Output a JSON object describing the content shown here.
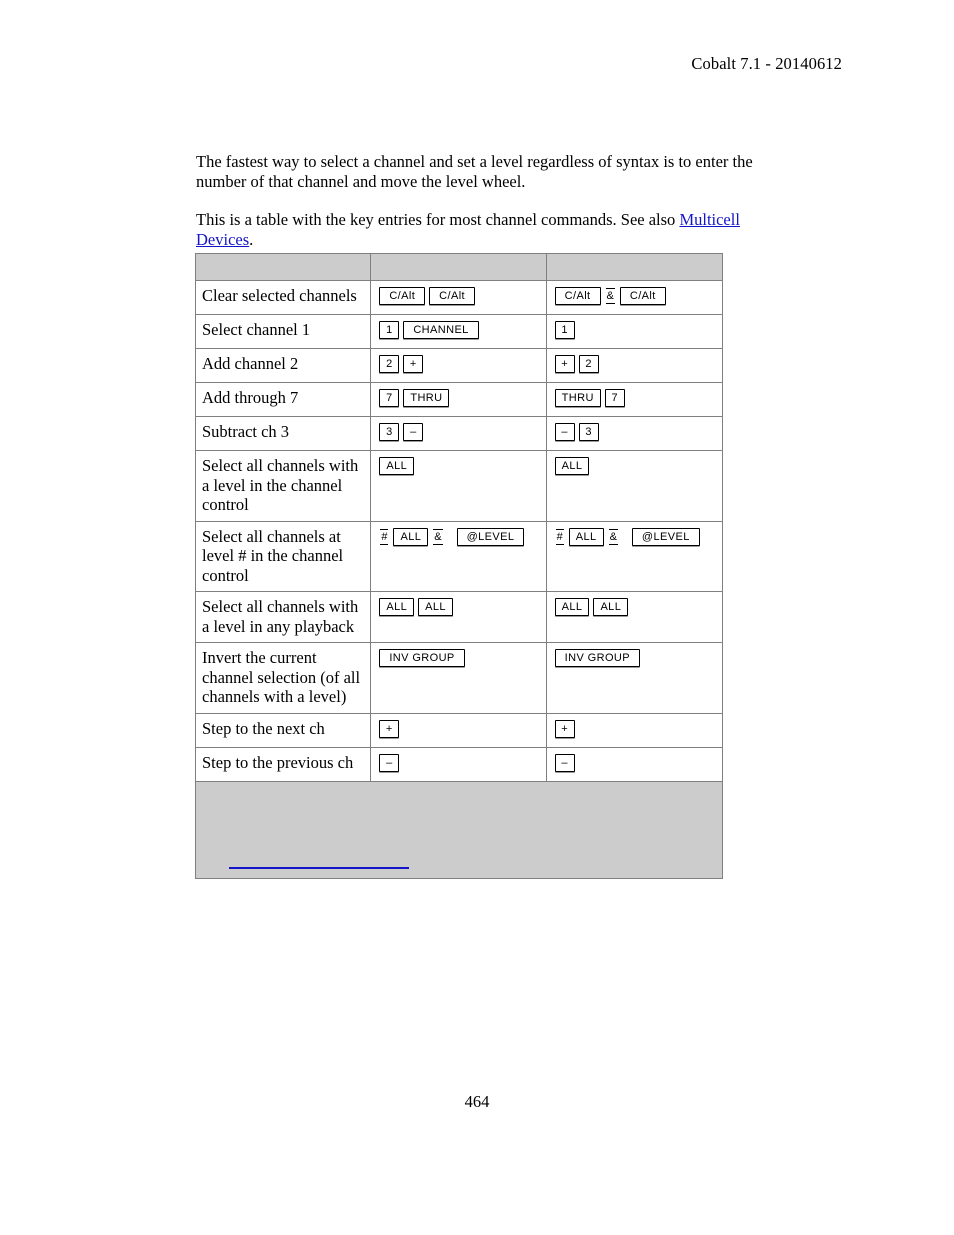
{
  "document": {
    "header": "Cobalt 7.1 - 20140612",
    "page_number": "464",
    "paragraphs": {
      "intro": "The fastest way to select a channel and set a level regardless of syntax is to enter the number of that channel and move the level wheel.",
      "table_lead_before_link": "This is a table with the key entries for most channel commands. See also ",
      "table_lead_link": "Multicell Devices",
      "table_lead_after_link": "."
    },
    "link_color": "#1414c8",
    "header_fill": "#cccccc",
    "border_color": "#7f7f7f"
  },
  "key_table": {
    "headers": [
      "",
      "",
      ""
    ],
    "rows": [
      {
        "description": "Clear selected channels",
        "syntax_a": [
          {
            "type": "key",
            "label": "C/Alt"
          },
          {
            "type": "key",
            "label": "C/Alt"
          }
        ],
        "syntax_b": [
          {
            "type": "key",
            "label": "C/Alt"
          },
          {
            "type": "lit",
            "label": "&"
          },
          {
            "type": "key",
            "label": "C/Alt"
          }
        ]
      },
      {
        "description": "Select channel 1",
        "syntax_a": [
          {
            "type": "key",
            "label": "1"
          },
          {
            "type": "key",
            "label": "CHANNEL"
          }
        ],
        "syntax_b": [
          {
            "type": "key",
            "label": "1"
          }
        ]
      },
      {
        "description": "Add channel 2",
        "syntax_a": [
          {
            "type": "key",
            "label": "2"
          },
          {
            "type": "key",
            "label": "+"
          }
        ],
        "syntax_b": [
          {
            "type": "key",
            "label": "+"
          },
          {
            "type": "key",
            "label": "2"
          }
        ]
      },
      {
        "description": "Add through 7",
        "syntax_a": [
          {
            "type": "key",
            "label": "7"
          },
          {
            "type": "key",
            "label": "THRU"
          }
        ],
        "syntax_b": [
          {
            "type": "key",
            "label": "THRU"
          },
          {
            "type": "key",
            "label": "7"
          }
        ]
      },
      {
        "description": "Subtract ch 3",
        "syntax_a": [
          {
            "type": "key",
            "label": "3"
          },
          {
            "type": "key",
            "label": "–"
          }
        ],
        "syntax_b": [
          {
            "type": "key",
            "label": "–"
          },
          {
            "type": "key",
            "label": "3"
          }
        ]
      },
      {
        "description": "Select all channels with a level in the channel control",
        "syntax_a": [
          {
            "type": "key",
            "label": "ALL"
          }
        ],
        "syntax_b": [
          {
            "type": "key",
            "label": "ALL"
          }
        ]
      },
      {
        "description": "Select all channels at level # in the channel control",
        "syntax_a": [
          {
            "type": "lit",
            "label": "#"
          },
          {
            "type": "key",
            "label": "ALL"
          },
          {
            "type": "lit",
            "label": "&"
          },
          {
            "type": "gap"
          },
          {
            "type": "key",
            "label": "@LEVEL"
          }
        ],
        "syntax_b": [
          {
            "type": "lit",
            "label": "#"
          },
          {
            "type": "key",
            "label": "ALL"
          },
          {
            "type": "lit",
            "label": "&"
          },
          {
            "type": "gap"
          },
          {
            "type": "key",
            "label": "@LEVEL"
          }
        ]
      },
      {
        "description": "Select all channels with a level in any playback",
        "syntax_a": [
          {
            "type": "key",
            "label": "ALL"
          },
          {
            "type": "key",
            "label": "ALL"
          }
        ],
        "syntax_b": [
          {
            "type": "key",
            "label": "ALL"
          },
          {
            "type": "key",
            "label": "ALL"
          }
        ]
      },
      {
        "description": "Invert the current channel selection (of all channels with a level)",
        "syntax_a": [
          {
            "type": "key",
            "label": "INV GROUP"
          }
        ],
        "syntax_b": [
          {
            "type": "key",
            "label": "INV GROUP"
          }
        ]
      },
      {
        "description": "Step to the next ch",
        "syntax_a": [
          {
            "type": "key",
            "label": "+"
          }
        ],
        "syntax_b": [
          {
            "type": "key",
            "label": "+"
          }
        ]
      },
      {
        "description": "Step to the previous ch",
        "syntax_a": [
          {
            "type": "key",
            "label": "–"
          }
        ],
        "syntax_b": [
          {
            "type": "key",
            "label": "–"
          }
        ]
      }
    ],
    "footer": {
      "link_label": ""
    }
  }
}
